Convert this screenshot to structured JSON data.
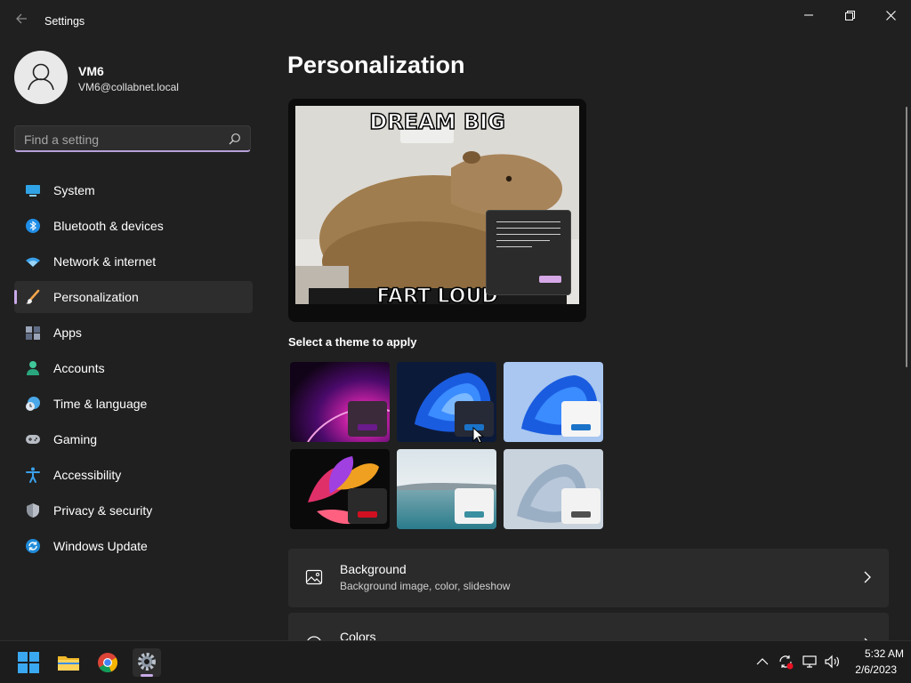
{
  "window": {
    "title": "Settings"
  },
  "user": {
    "name": "VM6",
    "email": "VM6@collabnet.local"
  },
  "search": {
    "placeholder": "Find a setting"
  },
  "nav": [
    {
      "label": "System",
      "icon": "system-icon"
    },
    {
      "label": "Bluetooth & devices",
      "icon": "bluetooth-icon"
    },
    {
      "label": "Network & internet",
      "icon": "wifi-icon"
    },
    {
      "label": "Personalization",
      "icon": "brush-icon",
      "active": true
    },
    {
      "label": "Apps",
      "icon": "apps-icon"
    },
    {
      "label": "Accounts",
      "icon": "accounts-icon"
    },
    {
      "label": "Time & language",
      "icon": "clock-globe-icon"
    },
    {
      "label": "Gaming",
      "icon": "gamepad-icon"
    },
    {
      "label": "Accessibility",
      "icon": "accessibility-icon"
    },
    {
      "label": "Privacy & security",
      "icon": "shield-icon"
    },
    {
      "label": "Windows Update",
      "icon": "update-icon"
    }
  ],
  "main": {
    "title": "Personalization",
    "preview": {
      "caption_top": "DREAM BIG",
      "caption_bottom": "FART LOUD"
    },
    "themes_label": "Select a theme to apply",
    "themes": [
      {
        "name": "purple-glow-theme",
        "accent": "#6a1a8a"
      },
      {
        "name": "windows-dark-bloom-theme",
        "accent": "#1a73c8"
      },
      {
        "name": "windows-light-bloom-theme",
        "accent": "#1a73c8"
      },
      {
        "name": "flower-theme",
        "accent": "#d01020"
      },
      {
        "name": "lake-theme",
        "accent": "#3a8fa0"
      },
      {
        "name": "silver-bloom-theme",
        "accent": "#505050"
      }
    ],
    "cards": [
      {
        "title": "Background",
        "subtitle": "Background image, color, slideshow",
        "icon": "image-icon"
      },
      {
        "title": "Colors",
        "subtitle": "",
        "icon": "palette-icon"
      }
    ]
  },
  "taskbar": {
    "time": "5:32 AM",
    "date": "2/6/2023"
  },
  "colors": {
    "accent": "#c9a9e8",
    "background": "#202020",
    "card": "#2b2b2b"
  }
}
